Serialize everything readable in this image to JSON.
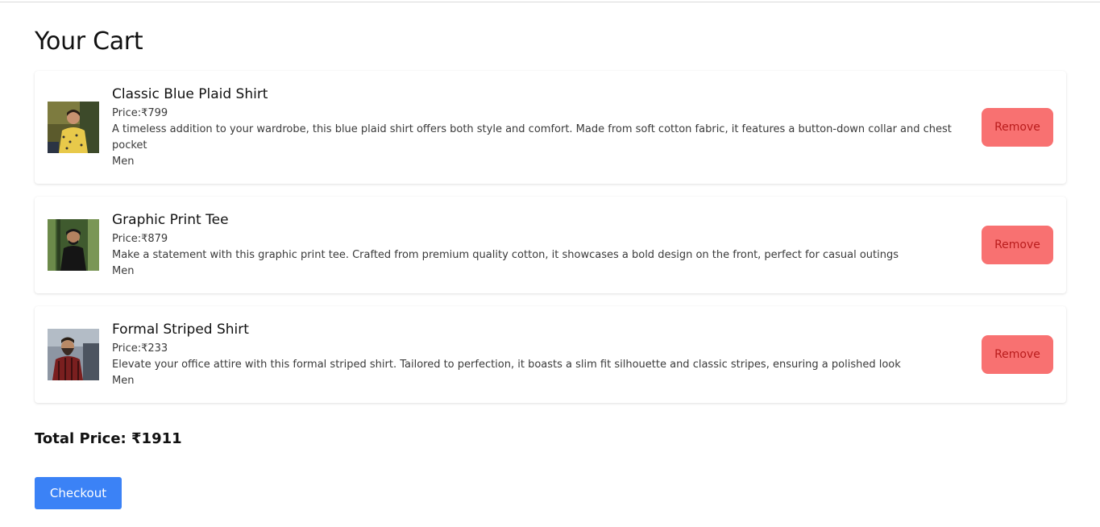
{
  "page": {
    "title": "Your Cart"
  },
  "cart": {
    "items": [
      {
        "name": "Classic Blue Plaid Shirt",
        "price": "Price:₹799",
        "description": "A timeless addition to your wardrobe, this blue plaid shirt offers both style and comfort. Made from soft cotton fabric, it features a button-down collar and chest pocket",
        "category": "Men",
        "remove_label": "Remove"
      },
      {
        "name": "Graphic Print Tee",
        "price": "Price:₹879",
        "description": "Make a statement with this graphic print tee. Crafted from premium quality cotton, it showcases a bold design on the front, perfect for casual outings",
        "category": "Men",
        "remove_label": "Remove"
      },
      {
        "name": "Formal Striped Shirt",
        "price": "Price:₹233",
        "description": "Elevate your office attire with this formal striped shirt. Tailored to perfection, it boasts a slim fit silhouette and classic stripes, ensuring a polished look",
        "category": "Men",
        "remove_label": "Remove"
      }
    ]
  },
  "summary": {
    "total_label": "Total Price: ₹1911",
    "checkout_label": "Checkout"
  },
  "colors": {
    "remove_bg": "#f87171",
    "remove_text": "#b91c1c",
    "checkout_bg": "#3b82f6"
  }
}
